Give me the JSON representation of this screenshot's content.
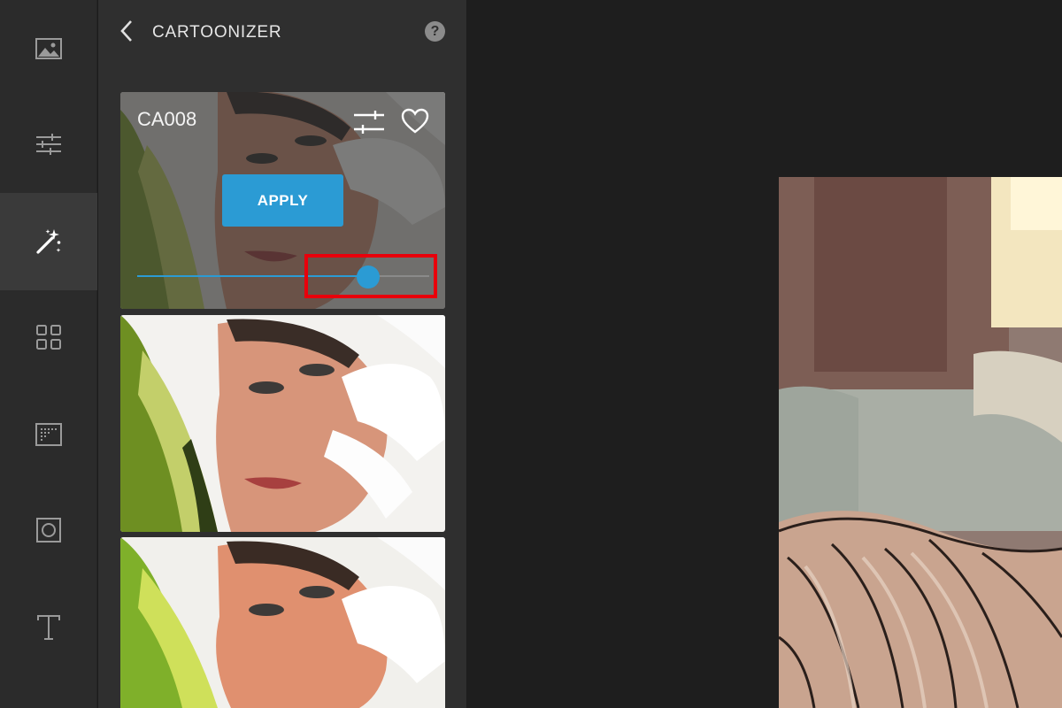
{
  "sidebar": {
    "items": [
      {
        "icon": "image-icon"
      },
      {
        "icon": "sliders-icon"
      },
      {
        "icon": "magic-wand-icon",
        "active": true
      },
      {
        "icon": "grid-icon"
      },
      {
        "icon": "texture-icon"
      },
      {
        "icon": "frame-icon"
      },
      {
        "icon": "text-icon"
      }
    ]
  },
  "panel": {
    "title": "CARTOONIZER",
    "help": "?"
  },
  "presets": [
    {
      "name": "CA008",
      "apply_label": "APPLY",
      "strength": 0.79,
      "active": true
    },
    {
      "name": ""
    },
    {
      "name": ""
    }
  ],
  "colors": {
    "accent": "#2b9bd4",
    "highlight": "#e8000b",
    "rail_bg": "#2b2b2b",
    "panel_bg": "#2f2f2f",
    "canvas_bg": "#1e1e1e"
  }
}
